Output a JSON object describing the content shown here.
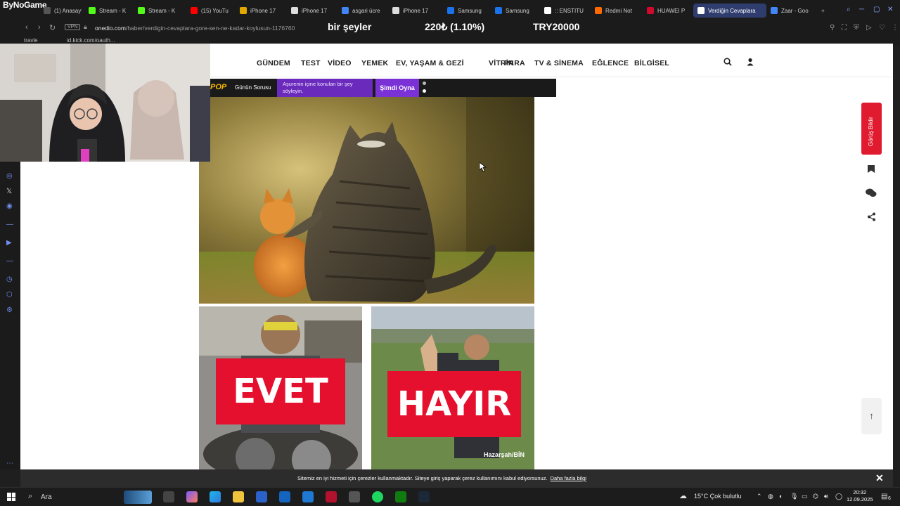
{
  "browser": {
    "brand": "ByNoGame",
    "tabs": [
      {
        "label": "(1) Anasayf",
        "color": "#555555"
      },
      {
        "label": "Stream - K",
        "color": "#53fc18"
      },
      {
        "label": "Stream - K",
        "color": "#53fc18"
      },
      {
        "label": "(15) YouTu",
        "color": "#ff0000"
      },
      {
        "label": "iPhone 17",
        "color": "#e0a800"
      },
      {
        "label": "iPhone 17",
        "color": "#dddddd"
      },
      {
        "label": "asgari ücre",
        "color": "#4285f4"
      },
      {
        "label": "iPhone 17",
        "color": "#dddddd"
      },
      {
        "label": "Samsung",
        "color": "#1a73e8"
      },
      {
        "label": "Samsung",
        "color": "#1a73e8"
      },
      {
        "label": ":: ENSTITU",
        "color": "#ffffff"
      },
      {
        "label": "Redmi Not",
        "color": "#ff6900"
      },
      {
        "label": "HUAWEI P",
        "color": "#cf0a2c"
      },
      {
        "label": "Verdiğin Cevaplara",
        "color": "#ffffff",
        "active": true
      },
      {
        "label": "Zaar - Goo",
        "color": "#4285f4"
      }
    ],
    "vpn_label": "VPN",
    "url_host": "onedio.com",
    "url_path": "/haber/verdigin-cevaplara-gore-sen-ne-kadar-koylusun-1176760",
    "bookmarks": [
      "travle",
      "id.kick.com/oauth..."
    ]
  },
  "stream_overlay": {
    "text1": "bir şeyler",
    "text2": "220₺ (1.10%)",
    "text3": "TRY20000"
  },
  "site": {
    "nav": [
      "GÜNDEM",
      "TEST",
      "VİDEO",
      "YEMEK",
      "EV, YAŞAM & GEZİ",
      "VİTRİN",
      "PARA",
      "TV & SİNEMA",
      "EĞLENCE",
      "BİLGİSEL"
    ],
    "pop": {
      "logo": "POP",
      "question_title": "Günün Sorusu",
      "question_text": "Aşurenin içine konulan bir şey söyleyin.",
      "play_label": "Şimdi Oyna"
    },
    "answers": {
      "yes_label": "EVET",
      "no_label": "HAYIR",
      "watermark": "Hazarşah/BİN"
    },
    "feedback_label": "Görüş Bildir",
    "cookie_text": "Sitemiz en iyi hizmeti için çerezler kullanmaktadır. Siteye giriş yaparak çerez kullanımını kabul ediyorsunuz.",
    "cookie_link": "Daha fazla bilgi"
  },
  "taskbar": {
    "search_label": "Ara",
    "weather": "15°C  Çok bulutlu",
    "time": "20:32",
    "date": "12.09.2025",
    "notif_count": "6"
  }
}
